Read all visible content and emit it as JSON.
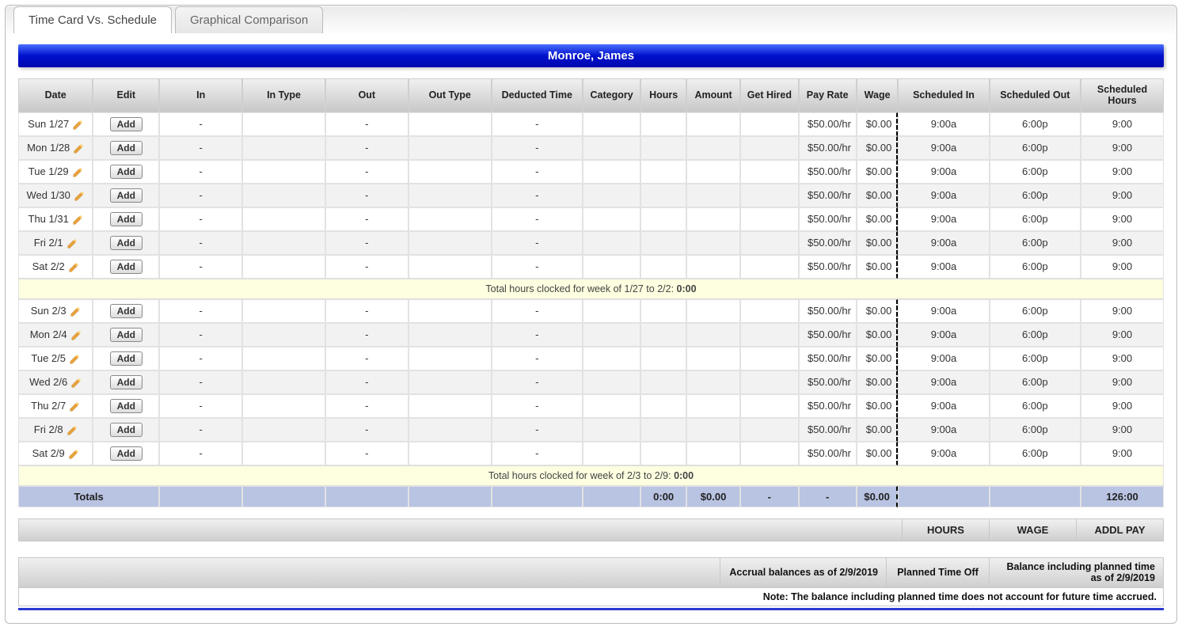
{
  "tabs": {
    "active": "Time Card Vs. Schedule",
    "inactive": "Graphical Comparison"
  },
  "employee_name": "Monroe, James",
  "columns": {
    "date": "Date",
    "edit": "Edit",
    "in": "In",
    "in_type": "In Type",
    "out": "Out",
    "out_type": "Out Type",
    "deducted": "Deducted Time",
    "category": "Category",
    "hours": "Hours",
    "amount": "Amount",
    "get_hired": "Get Hired",
    "pay_rate": "Pay Rate",
    "wage": "Wage",
    "sched_in": "Scheduled In",
    "sched_out": "Scheduled Out",
    "sched_hours": "Scheduled Hours"
  },
  "add_label": "Add",
  "weeks": [
    {
      "summary_prefix": "Total hours clocked for week of 1/27 to 2/2: ",
      "summary_value": "0:00",
      "rows": [
        {
          "date": "Sun 1/27",
          "in": "-",
          "out": "-",
          "deducted": "-",
          "pay_rate": "$50.00/hr",
          "wage": "$0.00",
          "sin": "9:00a",
          "sout": "6:00p",
          "shours": "9:00"
        },
        {
          "date": "Mon 1/28",
          "in": "-",
          "out": "-",
          "deducted": "-",
          "pay_rate": "$50.00/hr",
          "wage": "$0.00",
          "sin": "9:00a",
          "sout": "6:00p",
          "shours": "9:00"
        },
        {
          "date": "Tue 1/29",
          "in": "-",
          "out": "-",
          "deducted": "-",
          "pay_rate": "$50.00/hr",
          "wage": "$0.00",
          "sin": "9:00a",
          "sout": "6:00p",
          "shours": "9:00"
        },
        {
          "date": "Wed 1/30",
          "in": "-",
          "out": "-",
          "deducted": "-",
          "pay_rate": "$50.00/hr",
          "wage": "$0.00",
          "sin": "9:00a",
          "sout": "6:00p",
          "shours": "9:00"
        },
        {
          "date": "Thu 1/31",
          "in": "-",
          "out": "-",
          "deducted": "-",
          "pay_rate": "$50.00/hr",
          "wage": "$0.00",
          "sin": "9:00a",
          "sout": "6:00p",
          "shours": "9:00"
        },
        {
          "date": "Fri 2/1",
          "in": "-",
          "out": "-",
          "deducted": "-",
          "pay_rate": "$50.00/hr",
          "wage": "$0.00",
          "sin": "9:00a",
          "sout": "6:00p",
          "shours": "9:00"
        },
        {
          "date": "Sat 2/2",
          "in": "-",
          "out": "-",
          "deducted": "-",
          "pay_rate": "$50.00/hr",
          "wage": "$0.00",
          "sin": "9:00a",
          "sout": "6:00p",
          "shours": "9:00"
        }
      ]
    },
    {
      "summary_prefix": "Total hours clocked for week of 2/3 to 2/9: ",
      "summary_value": "0:00",
      "rows": [
        {
          "date": "Sun 2/3",
          "in": "-",
          "out": "-",
          "deducted": "-",
          "pay_rate": "$50.00/hr",
          "wage": "$0.00",
          "sin": "9:00a",
          "sout": "6:00p",
          "shours": "9:00"
        },
        {
          "date": "Mon 2/4",
          "in": "-",
          "out": "-",
          "deducted": "-",
          "pay_rate": "$50.00/hr",
          "wage": "$0.00",
          "sin": "9:00a",
          "sout": "6:00p",
          "shours": "9:00"
        },
        {
          "date": "Tue 2/5",
          "in": "-",
          "out": "-",
          "deducted": "-",
          "pay_rate": "$50.00/hr",
          "wage": "$0.00",
          "sin": "9:00a",
          "sout": "6:00p",
          "shours": "9:00"
        },
        {
          "date": "Wed 2/6",
          "in": "-",
          "out": "-",
          "deducted": "-",
          "pay_rate": "$50.00/hr",
          "wage": "$0.00",
          "sin": "9:00a",
          "sout": "6:00p",
          "shours": "9:00"
        },
        {
          "date": "Thu 2/7",
          "in": "-",
          "out": "-",
          "deducted": "-",
          "pay_rate": "$50.00/hr",
          "wage": "$0.00",
          "sin": "9:00a",
          "sout": "6:00p",
          "shours": "9:00"
        },
        {
          "date": "Fri 2/8",
          "in": "-",
          "out": "-",
          "deducted": "-",
          "pay_rate": "$50.00/hr",
          "wage": "$0.00",
          "sin": "9:00a",
          "sout": "6:00p",
          "shours": "9:00"
        },
        {
          "date": "Sat 2/9",
          "in": "-",
          "out": "-",
          "deducted": "-",
          "pay_rate": "$50.00/hr",
          "wage": "$0.00",
          "sin": "9:00a",
          "sout": "6:00p",
          "shours": "9:00"
        }
      ]
    }
  ],
  "totals": {
    "label": "Totals",
    "hours": "0:00",
    "amount": "$0.00",
    "get_hired": "-",
    "pay_rate": "-",
    "wage": "$0.00",
    "sched_hours": "126:00"
  },
  "footer": {
    "hours": "HOURS",
    "wage": "WAGE",
    "addl": "ADDL PAY"
  },
  "accrual": {
    "col1": "Accrual balances as of 2/9/2019",
    "col2": "Planned Time Off",
    "col3": "Balance including planned time as of 2/9/2019",
    "note": "Note: The balance including planned time does not account for future time accrued."
  }
}
